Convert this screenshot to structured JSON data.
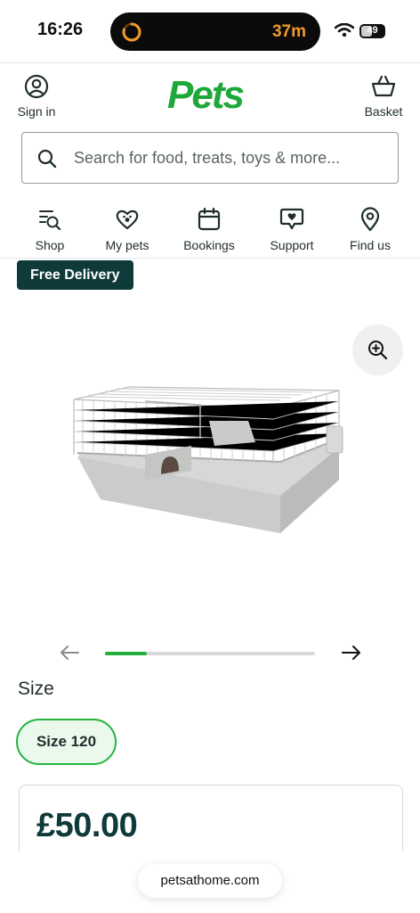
{
  "status_bar": {
    "time": "16:26",
    "timer": "37m",
    "battery_level": "49",
    "battery_fraction": 0.49,
    "timer_color": "#f39a2b"
  },
  "header": {
    "sign_in_label": "Sign in",
    "logo_text": "Pets",
    "basket_label": "Basket",
    "brand_color": "#1fa83a"
  },
  "search": {
    "placeholder": "Search for food, treats, toys & more..."
  },
  "nav": {
    "items": [
      {
        "label": "Shop",
        "icon": "shop-search-icon"
      },
      {
        "label": "My pets",
        "icon": "heart-paw-icon"
      },
      {
        "label": "Bookings",
        "icon": "calendar-icon"
      },
      {
        "label": "Support",
        "icon": "chat-heart-icon"
      },
      {
        "label": "Find us",
        "icon": "location-pin-icon"
      }
    ]
  },
  "product": {
    "badge": "Free Delivery",
    "image_icon": "rabbit-cage-image",
    "carousel_progress": 0.2,
    "size_heading": "Size",
    "size_option": "Size 120",
    "price": "£50.00",
    "accent_color": "#22b03b"
  },
  "browser": {
    "url": "petsathome.com"
  }
}
